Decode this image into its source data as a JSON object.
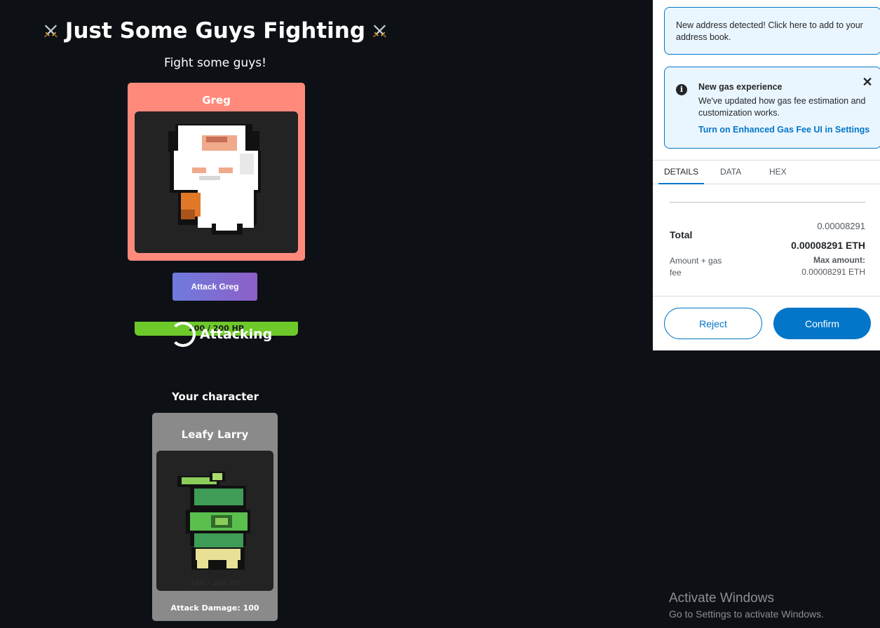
{
  "game": {
    "title": "Just Some Guys Fighting",
    "subtitle": "Fight some guys!",
    "boss": {
      "name": "Greg",
      "hp": "200 / 200 HP",
      "hp_fraction": 1.0,
      "card_color": "#ff8a7c",
      "hp_color": "#6ec92a"
    },
    "attack_button": "Attack Greg",
    "attacking_status": "Attacking",
    "your_character_label": "Your character",
    "player": {
      "name": "Leafy Larry",
      "hp": "100 / 100 HP",
      "attack_damage": "Attack Damage: 100"
    }
  },
  "metamask": {
    "notice_address": "New address detected! Click here to add to your address book.",
    "notice_gas": {
      "title": "New gas experience",
      "body": "We've updated how gas fee estimation and customization works.",
      "link": "Turn on Enhanced Gas Fee UI in Settings"
    },
    "tabs": [
      "DETAILS",
      "DATA",
      "HEX"
    ],
    "active_tab": "DETAILS",
    "total": {
      "label": "Total",
      "value": "0.00008291",
      "value_eth": "0.00008291 ETH"
    },
    "amount_label": "Amount + gas fee",
    "max_amount_label": "Max amount:",
    "max_amount_value": "0.00008291 ETH",
    "reject_label": "Reject",
    "confirm_label": "Confirm",
    "accent_color": "#0376c9"
  },
  "watermark": {
    "title": "Activate Windows",
    "subtitle": "Go to Settings to activate Windows."
  }
}
